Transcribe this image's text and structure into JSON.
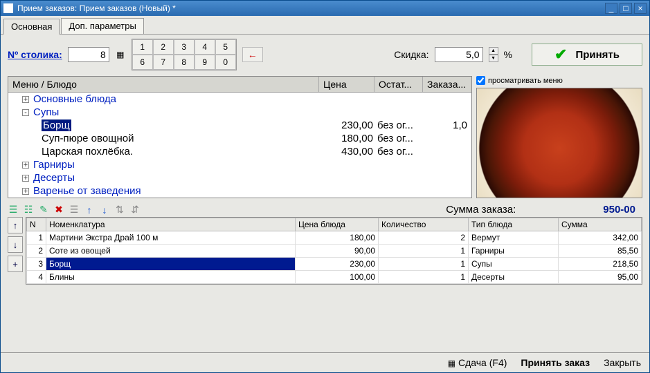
{
  "title": "Прием заказов: Прием заказов (Новый) *",
  "tabs": {
    "main": "Основная",
    "extra": "Доп. параметры"
  },
  "toolbar": {
    "table_no_label": "Nº столика:",
    "table_no_value": "8",
    "numpad": [
      "1",
      "2",
      "3",
      "4",
      "5",
      "6",
      "7",
      "8",
      "9",
      "0"
    ],
    "back": "←",
    "discount_label": "Скидка:",
    "discount_value": "5,0",
    "pct": "%",
    "accept_label": "Принять"
  },
  "menu": {
    "header": {
      "name": "Меню / Блюдо",
      "price": "Цена",
      "stock": "Остат...",
      "order": "Заказа..."
    },
    "preview_check": "просматривать меню",
    "tree": [
      {
        "label": "Основные блюда",
        "type": "group",
        "level": 1,
        "toggle": "+"
      },
      {
        "label": "Супы",
        "type": "group",
        "level": 1,
        "toggle": "-"
      },
      {
        "label": "Борщ",
        "type": "item",
        "level": 2,
        "price": "230,00",
        "stock": "без ог...",
        "order": "1,0",
        "selected": true
      },
      {
        "label": "Суп-пюре овощной",
        "type": "item",
        "level": 2,
        "price": "180,00",
        "stock": "без ог..."
      },
      {
        "label": "Царская похлёбка.",
        "type": "item",
        "level": 2,
        "price": "430,00",
        "stock": "без ог..."
      },
      {
        "label": "Гарниры",
        "type": "group",
        "level": 1,
        "toggle": "+"
      },
      {
        "label": "Десерты",
        "type": "group",
        "level": 1,
        "toggle": "+"
      },
      {
        "label": "Варенье от заведения",
        "type": "group",
        "level": 1,
        "toggle": "+"
      }
    ]
  },
  "summary": {
    "label": "Сумма заказа:",
    "value": "950-00"
  },
  "order": {
    "header": {
      "n": "N",
      "name": "Номенклатура",
      "price": "Цена блюда",
      "qty": "Количество",
      "type": "Тип блюда",
      "sum": "Сумма"
    },
    "rows": [
      {
        "n": "1",
        "name": "Мартини Экстра Драй 100 м",
        "price": "180,00",
        "qty": "2",
        "type": "Вермут",
        "sum": "342,00"
      },
      {
        "n": "2",
        "name": "Соте из овощей",
        "price": "90,00",
        "qty": "1",
        "type": "Гарниры",
        "sum": "85,50"
      },
      {
        "n": "3",
        "name": "Борщ",
        "price": "230,00",
        "qty": "1",
        "type": "Супы",
        "sum": "218,50",
        "selected": true
      },
      {
        "n": "4",
        "name": "Блины",
        "price": "100,00",
        "qty": "1",
        "type": "Десерты",
        "sum": "95,00"
      }
    ]
  },
  "footer": {
    "change": "Сдача (F4)",
    "accept_order": "Принять заказ",
    "close": "Закрыть"
  }
}
